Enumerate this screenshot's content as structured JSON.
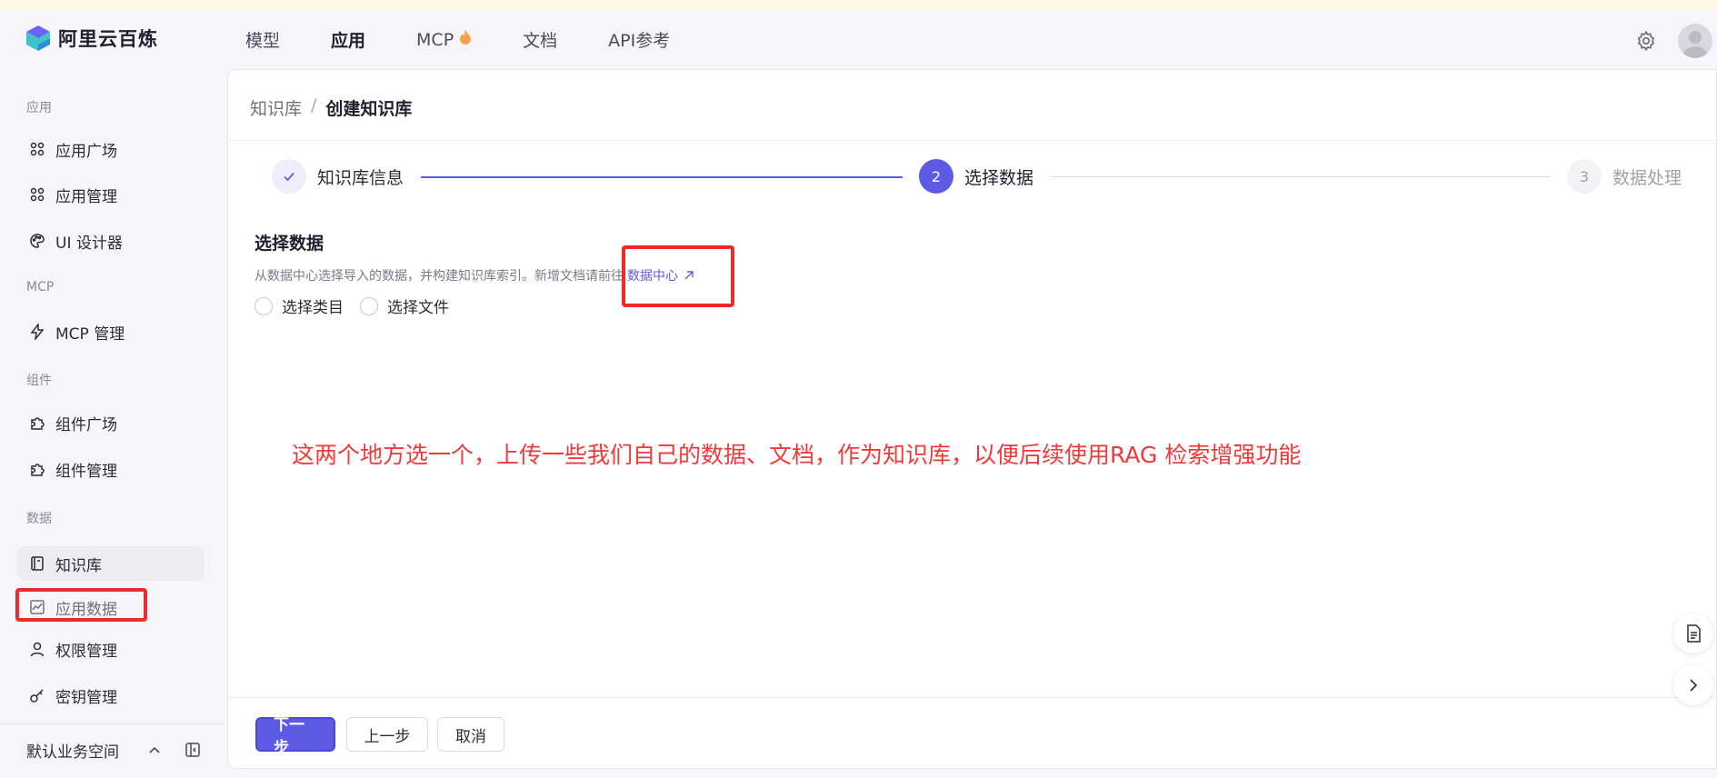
{
  "brand": {
    "name": "阿里云百炼"
  },
  "topnav": {
    "items": [
      {
        "label": "模型"
      },
      {
        "label": "应用"
      },
      {
        "label": "MCP"
      },
      {
        "label": "文档"
      },
      {
        "label": "API参考"
      }
    ],
    "active": "应用"
  },
  "sidebar": {
    "sections": [
      "应用",
      "MCP",
      "组件",
      "数据"
    ],
    "items": [
      {
        "label": "应用广场"
      },
      {
        "label": "应用管理"
      },
      {
        "label": "UI 设计器"
      },
      {
        "label": "MCP 管理"
      },
      {
        "label": "组件广场"
      },
      {
        "label": "组件管理"
      },
      {
        "label": "知识库"
      },
      {
        "label": "应用数据"
      },
      {
        "label": "权限管理"
      },
      {
        "label": "密钥管理"
      }
    ],
    "workspace": "默认业务空间"
  },
  "breadcrumb": {
    "parent": "知识库",
    "separator": "/",
    "current": "创建知识库"
  },
  "steps": [
    {
      "number": "✓",
      "label": "知识库信息"
    },
    {
      "number": "2",
      "label": "选择数据"
    },
    {
      "number": "3",
      "label": "数据处理"
    }
  ],
  "section": {
    "title": "选择数据",
    "description": "从数据中心选择导入的数据，并构建知识库索引。新增文档请前往",
    "link": "数据中心",
    "options": [
      "选择类目",
      "选择文件"
    ]
  },
  "annotation": "这两个地方选一个，上传一些我们自己的数据、文档，作为知识库，以便后续使用RAG 检索增强功能",
  "footer": {
    "next": "下一步",
    "prev": "上一步",
    "cancel": "取消"
  },
  "colors": {
    "accent": "#5d5ae6",
    "annotation": "#f03a3a"
  }
}
